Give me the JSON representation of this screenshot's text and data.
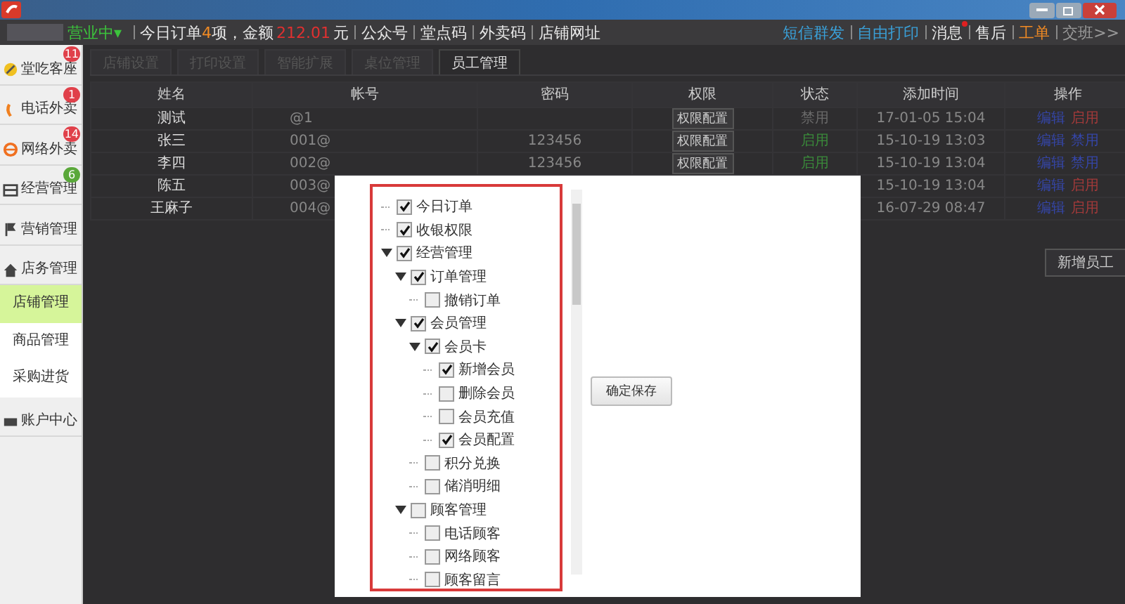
{
  "header": {
    "status": "营业中▾",
    "stats": [
      {
        "kind": "label",
        "text": "今日订单"
      },
      {
        "kind": "count",
        "text": "4"
      },
      {
        "kind": "label",
        "text": "项，金额"
      },
      {
        "kind": "amount",
        "text": "212.01"
      },
      {
        "kind": "label",
        "text": "元"
      }
    ],
    "links": [
      "公众号",
      "堂点码",
      "外卖码",
      "店铺网址"
    ],
    "right_links": [
      {
        "label": "短信群发",
        "color": "#3aa0d8",
        "unread": false
      },
      {
        "label": "自由打印",
        "color": "#3aa0d8",
        "unread": false
      },
      {
        "label": "消息",
        "color": "#e8e8e8",
        "unread": true
      },
      {
        "label": "售后",
        "color": "#e8e8e8",
        "unread": false
      },
      {
        "label": "工单",
        "color": "#f08a24",
        "unread": false
      },
      {
        "label": "交班>>",
        "color": "#9a9a9a",
        "unread": false
      }
    ]
  },
  "sidebar": {
    "items": [
      {
        "kind": "main",
        "label": "堂吃客座",
        "badge": {
          "text": "11",
          "color": "#e0404a"
        },
        "selected": false
      },
      {
        "kind": "main",
        "label": "电话外卖",
        "badge": {
          "text": "1",
          "color": "#e0404a"
        },
        "selected": false
      },
      {
        "kind": "main",
        "label": "网络外卖",
        "badge": {
          "text": "14",
          "color": "#e0404a"
        },
        "selected": false
      },
      {
        "kind": "main",
        "label": "经营管理",
        "badge": {
          "text": "6",
          "color": "#5aa83a"
        },
        "selected": false
      },
      {
        "kind": "main",
        "label": "营销管理",
        "selected": false
      },
      {
        "kind": "main",
        "label": "店务管理",
        "selected": false
      },
      {
        "kind": "sub",
        "label": "店铺管理",
        "selected": true
      },
      {
        "kind": "sub",
        "label": "商品管理",
        "selected": false
      },
      {
        "kind": "sub",
        "label": "采购进货",
        "selected": false
      },
      {
        "kind": "main",
        "label": "账户中心",
        "selected": false
      }
    ]
  },
  "tabs": [
    {
      "label": "店铺设置",
      "selected": false
    },
    {
      "label": "打印设置",
      "selected": false
    },
    {
      "label": "智能扩展",
      "selected": false
    },
    {
      "label": "桌位管理",
      "selected": false
    },
    {
      "label": "员工管理",
      "selected": true
    }
  ],
  "table": {
    "columns": [
      "姓名",
      "帐号",
      "密码",
      "权限",
      "状态",
      "添加时间",
      "操作"
    ],
    "rows": [
      {
        "name": "测试",
        "account": "@1",
        "permission": "权限配置",
        "status": "禁用",
        "status_on": false,
        "added": "17-01-05 15:04",
        "actions": [
          {
            "kind": "edit",
            "label": "编辑"
          },
          {
            "kind": "enable",
            "label": "启用"
          }
        ]
      },
      {
        "name": "张三",
        "account": "001@",
        "password": "123456",
        "permission": "权限配置",
        "status": "启用",
        "status_on": true,
        "added": "15-10-19 13:03",
        "actions": [
          {
            "kind": "edit",
            "label": "编辑"
          },
          {
            "kind": "disable",
            "label": "禁用"
          }
        ]
      },
      {
        "name": "李四",
        "account": "002@",
        "password": "123456",
        "permission": "权限配置",
        "status": "启用",
        "status_on": true,
        "added": "15-10-19 13:04",
        "actions": [
          {
            "kind": "edit",
            "label": "编辑"
          },
          {
            "kind": "disable",
            "label": "禁用"
          }
        ]
      },
      {
        "name": "陈五",
        "account": "003@",
        "added": "15-10-19 13:04",
        "actions": [
          {
            "kind": "edit",
            "label": "编辑"
          },
          {
            "kind": "enable",
            "label": "启用"
          }
        ]
      },
      {
        "name": "王麻子",
        "account": "004@",
        "added": "16-07-29 08:47",
        "actions": [
          {
            "kind": "edit",
            "label": "编辑"
          },
          {
            "kind": "enable",
            "label": "启用"
          }
        ]
      }
    ]
  },
  "add_button": "新增员工",
  "modal": {
    "save_button": "确定保存",
    "tree": [
      {
        "label": "今日订单",
        "checked": true
      },
      {
        "label": "收银权限",
        "checked": true
      },
      {
        "label": "经营管理",
        "checked": true,
        "expanded": true,
        "children": [
          {
            "label": "订单管理",
            "checked": true,
            "expanded": true,
            "children": [
              {
                "label": "撤销订单",
                "checked": false
              }
            ]
          },
          {
            "label": "会员管理",
            "checked": true,
            "expanded": true,
            "children": [
              {
                "label": "会员卡",
                "checked": true,
                "expanded": true,
                "children": [
                  {
                    "label": "新增会员",
                    "checked": true
                  },
                  {
                    "label": "删除会员",
                    "checked": false
                  },
                  {
                    "label": "会员充值",
                    "checked": false
                  },
                  {
                    "label": "会员配置",
                    "checked": true
                  }
                ]
              },
              {
                "label": "积分兑换",
                "checked": false
              },
              {
                "label": "储消明细",
                "checked": false
              }
            ]
          },
          {
            "label": "顾客管理",
            "checked": false,
            "expanded": true,
            "children": [
              {
                "label": "电话顾客",
                "checked": false
              },
              {
                "label": "网络顾客",
                "checked": false
              },
              {
                "label": "顾客留言",
                "checked": false
              }
            ]
          }
        ]
      }
    ]
  }
}
